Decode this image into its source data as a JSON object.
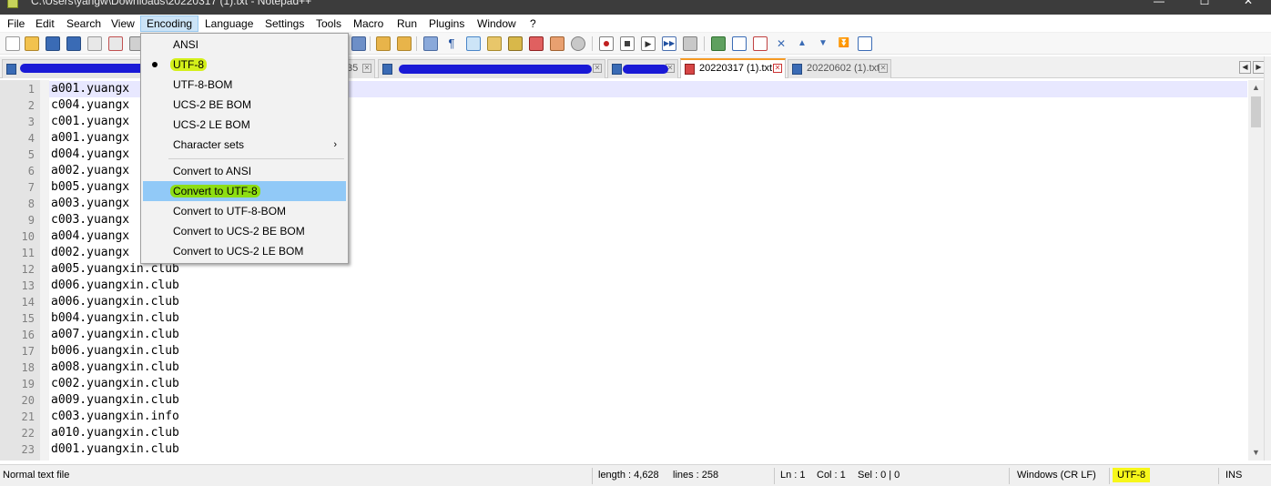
{
  "window": {
    "title": "C:\\Users\\yangw\\Downloads\\20220317 (1).txt - Notepad++",
    "controls": [
      "—",
      "☐",
      "✕"
    ]
  },
  "menubar": {
    "items": [
      "File",
      "Edit",
      "Search",
      "View",
      "Encoding",
      "Language",
      "Settings",
      "Tools",
      "Macro",
      "Run",
      "Plugins",
      "Window",
      "?"
    ],
    "active": "Encoding"
  },
  "tabs": [
    {
      "label": "",
      "redacted": true,
      "icon": "save-icon"
    },
    {
      "label": "35",
      "partially_redacted": true,
      "icon": "save-icon"
    },
    {
      "label": "",
      "redacted": true,
      "icon": "save-icon"
    },
    {
      "label": "",
      "redacted": true,
      "icon": "save-icon"
    },
    {
      "label": "20220317 (1).txt",
      "active": true,
      "icon": "unsaved-icon"
    },
    {
      "label": "20220602 (1).txt",
      "icon": "save-icon"
    }
  ],
  "tab_scroll": {
    "left": "◀",
    "right": "▶"
  },
  "encoding_menu": {
    "items": [
      {
        "label": "ANSI"
      },
      {
        "label": "UTF-8",
        "checked": true,
        "highlight": "#d4f01a"
      },
      {
        "label": "UTF-8-BOM"
      },
      {
        "label": "UCS-2 BE BOM"
      },
      {
        "label": "UCS-2 LE BOM"
      },
      {
        "label": "Character sets",
        "submenu": true,
        "arrow": "›"
      },
      {
        "label": "Convert to ANSI"
      },
      {
        "label": "Convert to UTF-8",
        "hover": true,
        "highlight": "#8ede13"
      },
      {
        "label": "Convert to UTF-8-BOM"
      },
      {
        "label": "Convert to UCS-2 BE BOM"
      },
      {
        "label": "Convert to UCS-2 LE BOM"
      }
    ]
  },
  "editor": {
    "lines": [
      {
        "n": "1",
        "text": "a001.yuangx"
      },
      {
        "n": "2",
        "text": "c004.yuangx"
      },
      {
        "n": "3",
        "text": "c001.yuangx"
      },
      {
        "n": "4",
        "text": "a001.yuangx"
      },
      {
        "n": "5",
        "text": "d004.yuangx"
      },
      {
        "n": "6",
        "text": "a002.yuangx"
      },
      {
        "n": "7",
        "text": "b005.yuangx"
      },
      {
        "n": "8",
        "text": "a003.yuangx"
      },
      {
        "n": "9",
        "text": "c003.yuangx"
      },
      {
        "n": "10",
        "text": "a004.yuangx"
      },
      {
        "n": "11",
        "text": "d002.yuangx"
      },
      {
        "n": "12",
        "text": "a005.yuangxin.club"
      },
      {
        "n": "13",
        "text": "d006.yuangxin.club"
      },
      {
        "n": "14",
        "text": "a006.yuangxin.club"
      },
      {
        "n": "15",
        "text": "b004.yuangxin.club"
      },
      {
        "n": "16",
        "text": "a007.yuangxin.club"
      },
      {
        "n": "17",
        "text": "b006.yuangxin.club"
      },
      {
        "n": "18",
        "text": "a008.yuangxin.club"
      },
      {
        "n": "19",
        "text": "c002.yuangxin.club"
      },
      {
        "n": "20",
        "text": "a009.yuangxin.club"
      },
      {
        "n": "21",
        "text": "c003.yuangxin.info"
      },
      {
        "n": "22",
        "text": "a010.yuangxin.club"
      },
      {
        "n": "23",
        "text": "d001.yuangxin.club"
      }
    ]
  },
  "scrollbar": {
    "up": "▲",
    "down": "▼"
  },
  "statusbar": {
    "file_type": "Normal text file",
    "length": "length : 4,628",
    "lines": "lines : 258",
    "ln": "Ln : 1",
    "col": "Col : 1",
    "sel": "Sel : 0 | 0",
    "eol": "Windows (CR LF)",
    "encoding": "UTF-8",
    "encoding_highlight": "#f7f71a",
    "mode": "INS"
  }
}
